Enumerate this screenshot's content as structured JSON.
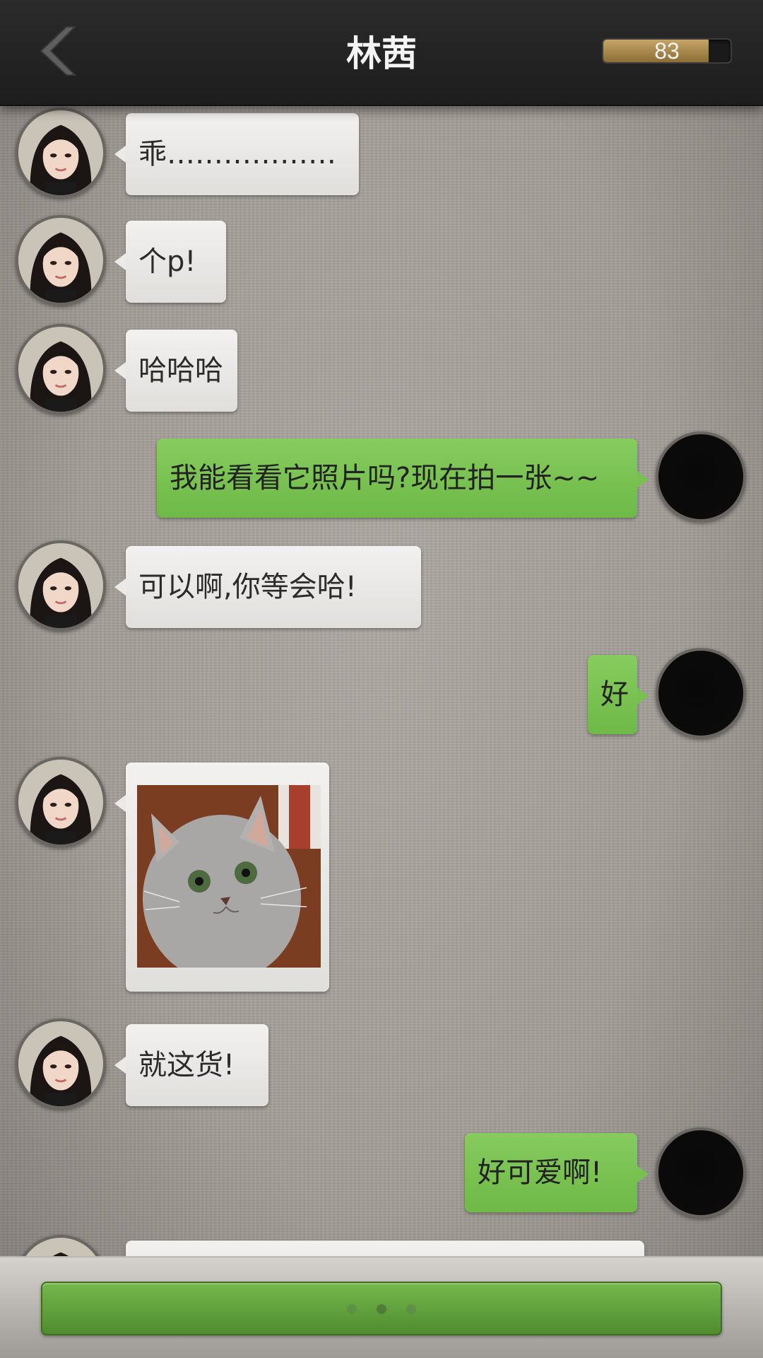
{
  "header": {
    "title": "林茜",
    "meter_value": "83",
    "meter_fraction": 0.83,
    "back_icon": "chevron-left-icon"
  },
  "colors": {
    "header_bg": "#222222",
    "gray_bubble": "#ebeae7",
    "green_bubble": "#78c150",
    "meter_fill": "#b0904f",
    "background": "#a39d97"
  },
  "messages": [
    {
      "side": "left",
      "type": "text",
      "text": "乖………………"
    },
    {
      "side": "left",
      "type": "text",
      "text": "个p!"
    },
    {
      "side": "left",
      "type": "text",
      "text": "哈哈哈"
    },
    {
      "side": "right",
      "type": "text",
      "text": "我能看看它照片吗?现在拍一张~~"
    },
    {
      "side": "left",
      "type": "text",
      "text": "可以啊,你等会哈!"
    },
    {
      "side": "right",
      "type": "text",
      "text": "好"
    },
    {
      "side": "left",
      "type": "image",
      "image": "cat-photo"
    },
    {
      "side": "left",
      "type": "text",
      "text": "就这货!"
    },
    {
      "side": "right",
      "type": "text",
      "text": "好可爱啊!"
    },
    {
      "side": "left",
      "type": "text",
      "text": ""
    }
  ],
  "bottom": {
    "dots": 3
  }
}
